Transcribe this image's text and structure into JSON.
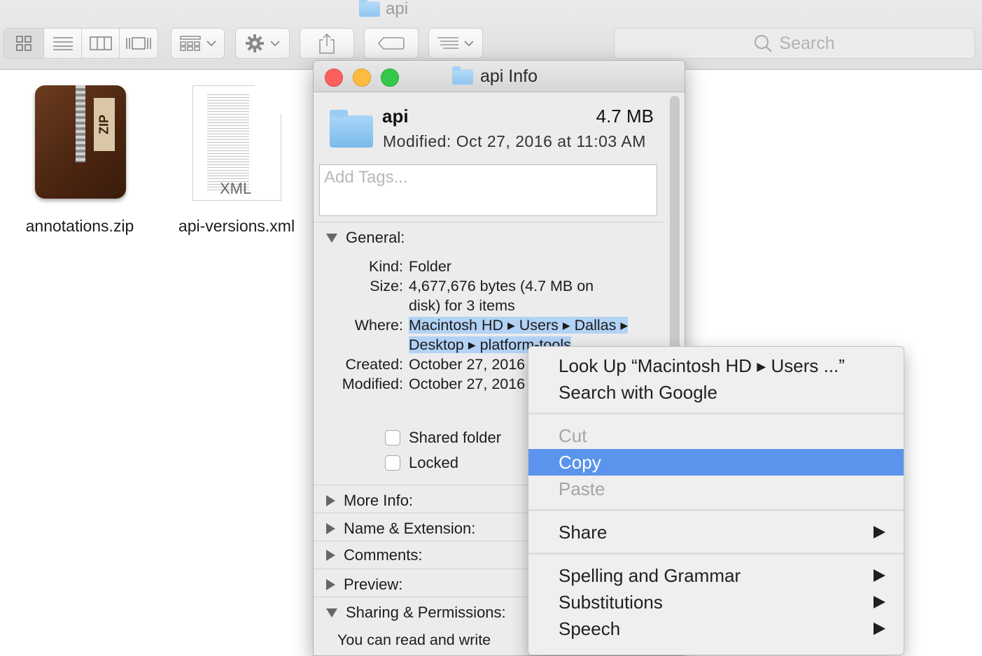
{
  "finder": {
    "title": "api",
    "search_placeholder": "Search"
  },
  "files": [
    {
      "name": "annotations.zip",
      "badge": "ZIP"
    },
    {
      "name": "api-versions.xml",
      "badge": "XML"
    }
  ],
  "info_window": {
    "title": "api Info",
    "name": "api",
    "size": "4.7 MB",
    "modified_line": "Modified:  Oct 27, 2016 at 11:03 AM",
    "tags_placeholder": "Add Tags...",
    "general": {
      "heading": "General:",
      "kind_label": "Kind:",
      "kind_value": "Folder",
      "size_label": "Size:",
      "size_value_1": "4,677,676 bytes (4.7 MB on",
      "size_value_2": "disk) for 3 items",
      "where_label": "Where:",
      "where_value_1": "Macintosh HD ▸ Users ▸ Dallas ▸",
      "where_value_2": "Desktop ▸ platform-tools",
      "created_label": "Created:",
      "created_value": "October 27, 2016",
      "modified_label": "Modified:",
      "modified_value": "October 27, 2016"
    },
    "checkboxes": {
      "shared": "Shared folder",
      "locked": "Locked"
    },
    "sections": [
      "More Info:",
      "Name & Extension:",
      "Comments:",
      "Preview:",
      "Sharing & Permissions:"
    ],
    "sharing_text": "You can read and write"
  },
  "context_menu": {
    "lookup": "Look Up “Macintosh HD ▸ Users ...”",
    "google": "Search with Google",
    "cut": "Cut",
    "copy": "Copy",
    "paste": "Paste",
    "share": "Share",
    "spelling": "Spelling and Grammar",
    "substitutions": "Substitutions",
    "speech": "Speech"
  }
}
